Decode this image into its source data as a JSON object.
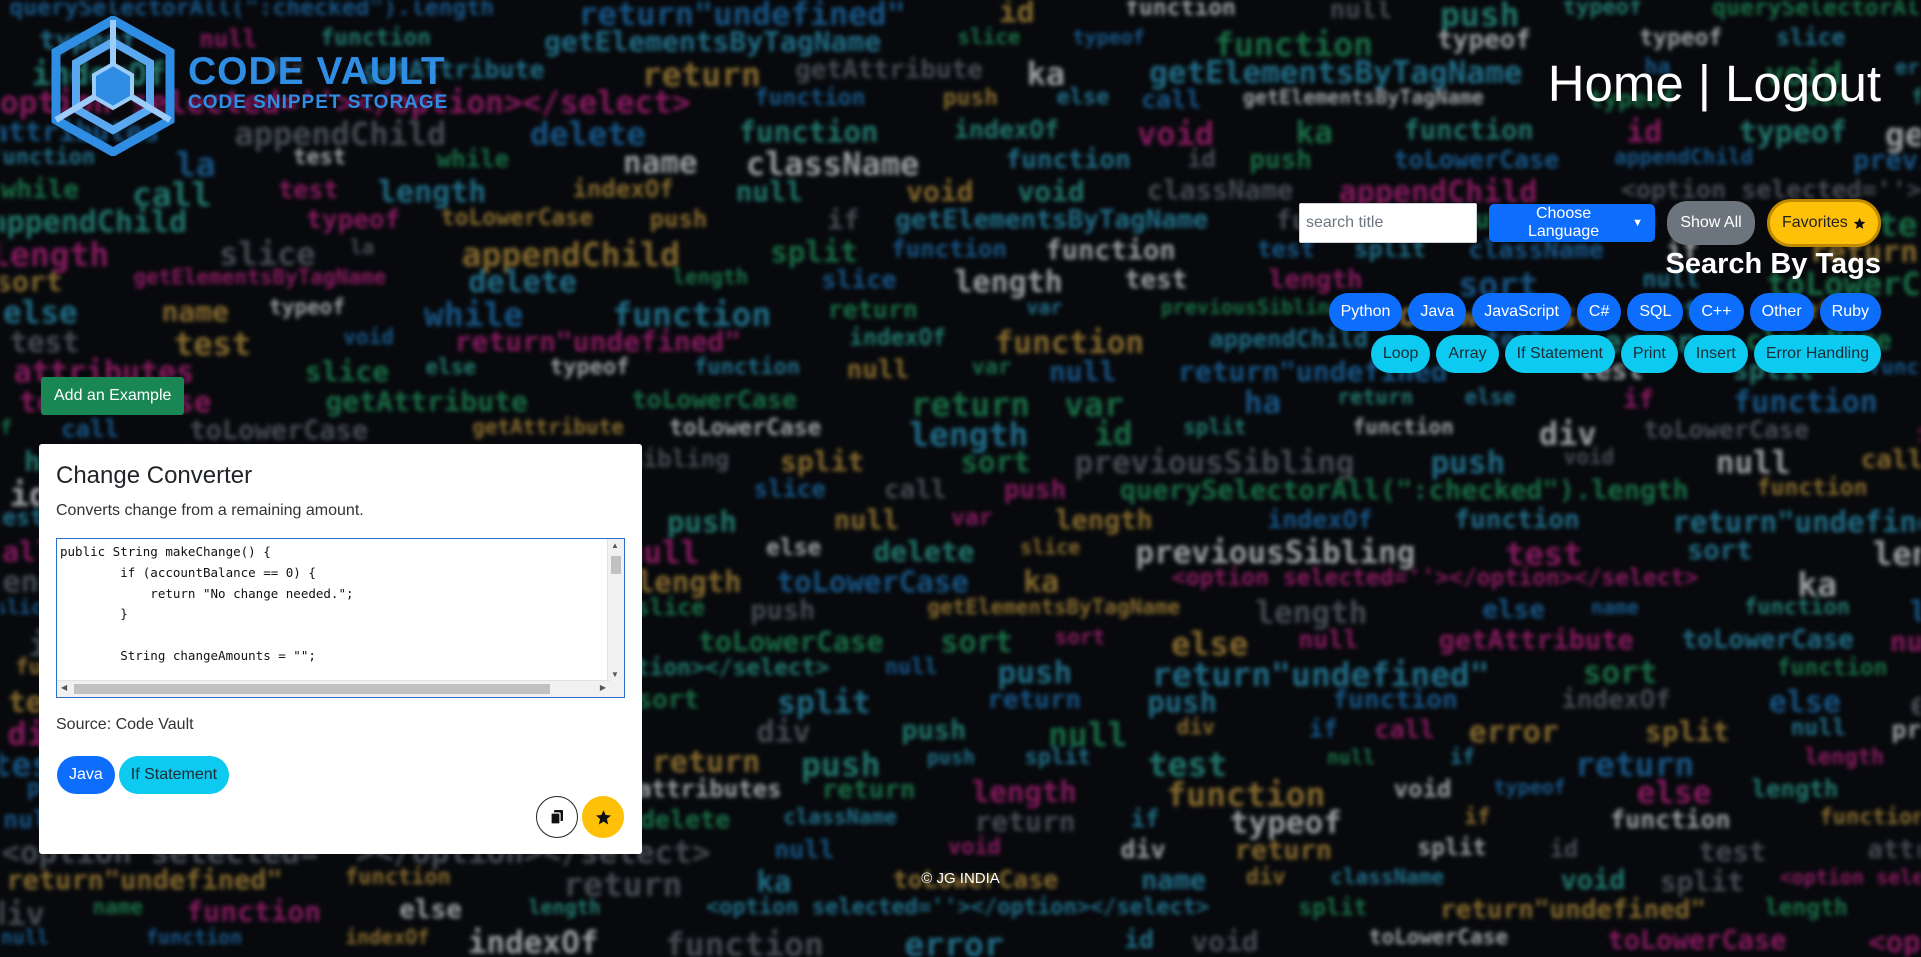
{
  "brand": {
    "title": "CODE VAULT",
    "subtitle": "CODE SNIPPET STORAGE",
    "color": "#2f8de4"
  },
  "nav": {
    "home": "Home",
    "separator": "|",
    "logout": "Logout"
  },
  "search": {
    "placeholder": "search title",
    "value": ""
  },
  "controls": {
    "language_label": "Choose Language",
    "show_all_label": "Show All",
    "favorites_label": "Favorites"
  },
  "tags_section": {
    "title": "Search By Tags",
    "language_tags": [
      "Python",
      "Java",
      "JavaScript",
      "C#",
      "SQL",
      "C++",
      "Other",
      "Ruby"
    ],
    "topic_tags": [
      "Loop",
      "Array",
      "If Statement",
      "Print",
      "Insert",
      "Error Handling"
    ]
  },
  "add_example_label": "Add an Example",
  "card": {
    "title": "Change Converter",
    "description": "Converts change from a remaining amount.",
    "code_lines": [
      "public String makeChange() {",
      "        if (accountBalance == 0) {",
      "            return \"No change needed.\";",
      "        }",
      "",
      "        String changeAmounts = \"\";"
    ],
    "source": "Source: Code Vault",
    "tags": [
      {
        "label": "Java",
        "kind": "language"
      },
      {
        "label": "If Statement",
        "kind": "topic"
      }
    ]
  },
  "footer": "© JG INDIA",
  "colors": {
    "primary": "#0d6efd",
    "info": "#0dcaf0",
    "secondary": "#6c757d",
    "warning": "#ffc107",
    "success": "#198754"
  },
  "background_code": [
    "length",
    "test",
    "push",
    "function",
    "var",
    "return",
    "split",
    "null",
    "toLowerCase",
    "length",
    "while",
    "function",
    "ha",
    "attributes",
    "la",
    "className",
    "getAttribute",
    "appendChild",
    "id",
    "delete",
    "typeof",
    "getElementsByTagName",
    "function",
    "return\"undefined\"",
    "<option selected=''></option></select>",
    "querySelectorAll(\":checked\").length",
    "push",
    "name",
    "call",
    "div",
    "return",
    "function",
    "void",
    "return",
    "slice",
    "sort",
    "else",
    "if",
    "error",
    "previousSibling",
    "toLowerCase",
    "toLowerCase",
    "null",
    "test",
    "indexOf",
    "ka"
  ]
}
